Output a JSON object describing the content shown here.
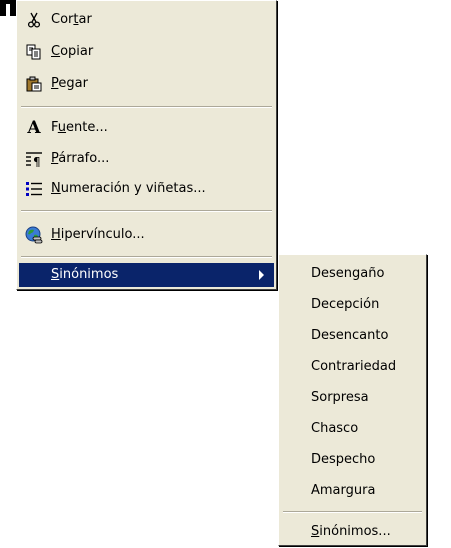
{
  "context_menu": {
    "items": [
      {
        "pre": "Cor",
        "key": "t",
        "post": "ar",
        "icon": "scissors-icon"
      },
      {
        "pre": "",
        "key": "C",
        "post": "opiar",
        "icon": "copy-icon"
      },
      {
        "pre": "",
        "key": "P",
        "post": "egar",
        "icon": "paste-icon"
      },
      {
        "pre": "F",
        "key": "u",
        "post": "ente...",
        "icon": "font-icon",
        "icon_glyph": "A"
      },
      {
        "pre": "",
        "key": "P",
        "post": "árrafo...",
        "icon": "paragraph-icon",
        "icon_glyph": "≡¶"
      },
      {
        "pre": "",
        "key": "N",
        "post": "umeración y viñetas...",
        "icon": "bullets-numbering-icon",
        "icon_glyph": "⋮☰"
      },
      {
        "pre": "",
        "key": "H",
        "post": "ipervínculo...",
        "icon": "hyperlink-globe-icon"
      },
      {
        "pre": "",
        "key": "S",
        "post": "inónimos",
        "icon": null
      }
    ]
  },
  "synonyms_submenu": {
    "items": [
      "Desengaño",
      "Decepción",
      "Desencanto",
      "Contrariedad",
      "Sorpresa",
      "Chasco",
      "Despecho",
      "Amargura"
    ],
    "footer": {
      "pre": "",
      "key": "S",
      "post": "inónimos..."
    }
  },
  "colors": {
    "menu_bg": "#ece9d8",
    "highlight_bg": "#0a246a",
    "highlight_text": "#ffffff"
  }
}
